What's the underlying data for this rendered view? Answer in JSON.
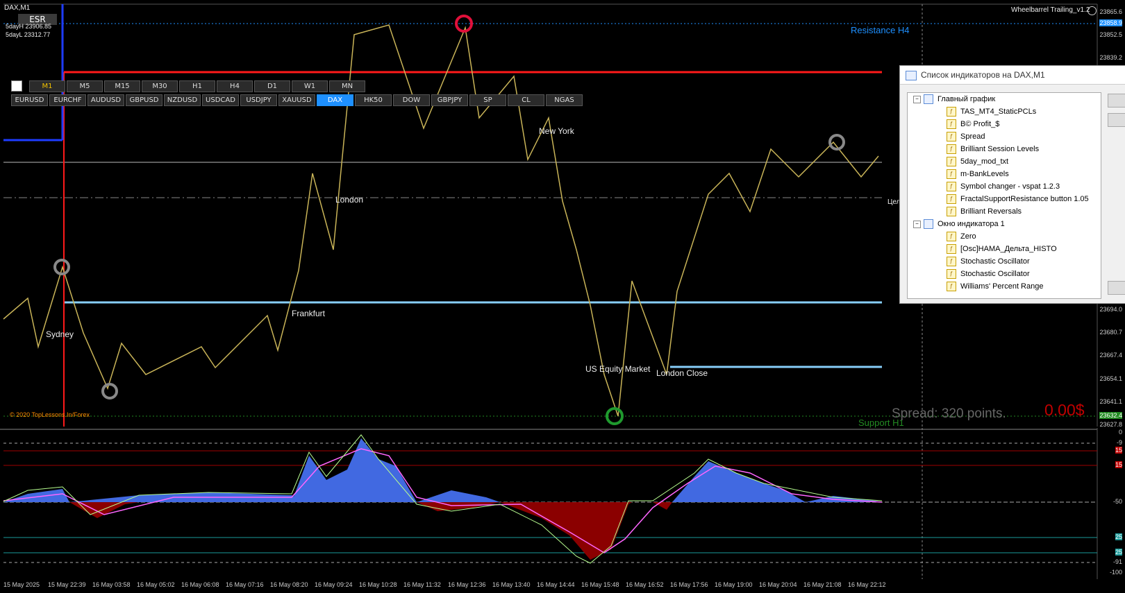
{
  "chart": {
    "symbol_title": "DAX,M1",
    "esr_button": "ESR",
    "five_day_high": "5dayH 23906.85",
    "five_day_low": "5dayL 23312.77",
    "ea_name": "Wheelbarrel Trailing_v1.2",
    "watermark": "© 2020 TopLessons.In/Forex",
    "spread_text": "Spread: 320 points.",
    "profit_text": "0.00$",
    "resistance_label": "Resistance H4",
    "support_label": "Support H1",
    "session_labels": [
      "Sydney",
      "London",
      "Frankfurt",
      "New York",
      "US Equity Market",
      "London Close"
    ],
    "cut_label": "Цел",
    "price_ticks": [
      "23865.6",
      "23858.9",
      "23852.5",
      "23839.2",
      "23694.0",
      "23680.7",
      "23667.4",
      "23654.1",
      "23641.1",
      "23632.4",
      "23627.8"
    ],
    "oscillator_ticks": [
      "0",
      "-9",
      "-50",
      "-91",
      "-100"
    ],
    "oscillator_level_tags": [
      "15",
      "15",
      "25",
      "25"
    ],
    "colors": {
      "resistance": "#ff1a1a",
      "support": "#87cefa",
      "price_line": "#c9b458",
      "blue_histo": "#4169e1",
      "red_histo": "#8b0000",
      "signal": "#ff66ff"
    }
  },
  "timeframes": {
    "items": [
      "M1",
      "M5",
      "M15",
      "M30",
      "H1",
      "H4",
      "D1",
      "W1",
      "MN"
    ],
    "active": "M1"
  },
  "symbols": {
    "items": [
      "EURUSD",
      "EURCHF",
      "AUDUSD",
      "GBPUSD",
      "NZDUSD",
      "USDCAD",
      "USDJPY",
      "XAUUSD",
      "DAX",
      "HK50",
      "DOW",
      "GBPJPY",
      "SP",
      "CL",
      "NGAS"
    ],
    "active": "DAX"
  },
  "time_axis": [
    "15 May 2025",
    "15 May 22:39",
    "16 May 03:58",
    "16 May 05:02",
    "16 May 06:08",
    "16 May 07:16",
    "16 May 08:20",
    "16 May 09:24",
    "16 May 10:28",
    "16 May 11:32",
    "16 May 12:36",
    "16 May 13:40",
    "16 May 14:44",
    "16 May 15:48",
    "16 May 16:52",
    "16 May 17:56",
    "16 May 19:00",
    "16 May 20:04",
    "16 May 21:08",
    "16 May 22:12"
  ],
  "indicator_panel": {
    "title": "Список индикаторов на DAX,M1",
    "groups": [
      {
        "name": "Главный график",
        "items": [
          "TAS_MT4_StaticPCLs",
          "B© Profit_$",
          "Spread",
          "Brilliant Session Levels",
          "5day_mod_txt",
          "m-BankLevels",
          "Symbol changer - vspat 1.2.3",
          "FractalSupportResistance button 1.05",
          "Brilliant Reversals"
        ]
      },
      {
        "name": "Окно индикатора 1",
        "items": [
          "Zero",
          "[Osc]HAMA_Дельта_HISTO",
          "Stochastic Oscillator",
          "Stochastic Oscillator",
          "Williams' Percent Range"
        ]
      }
    ]
  }
}
